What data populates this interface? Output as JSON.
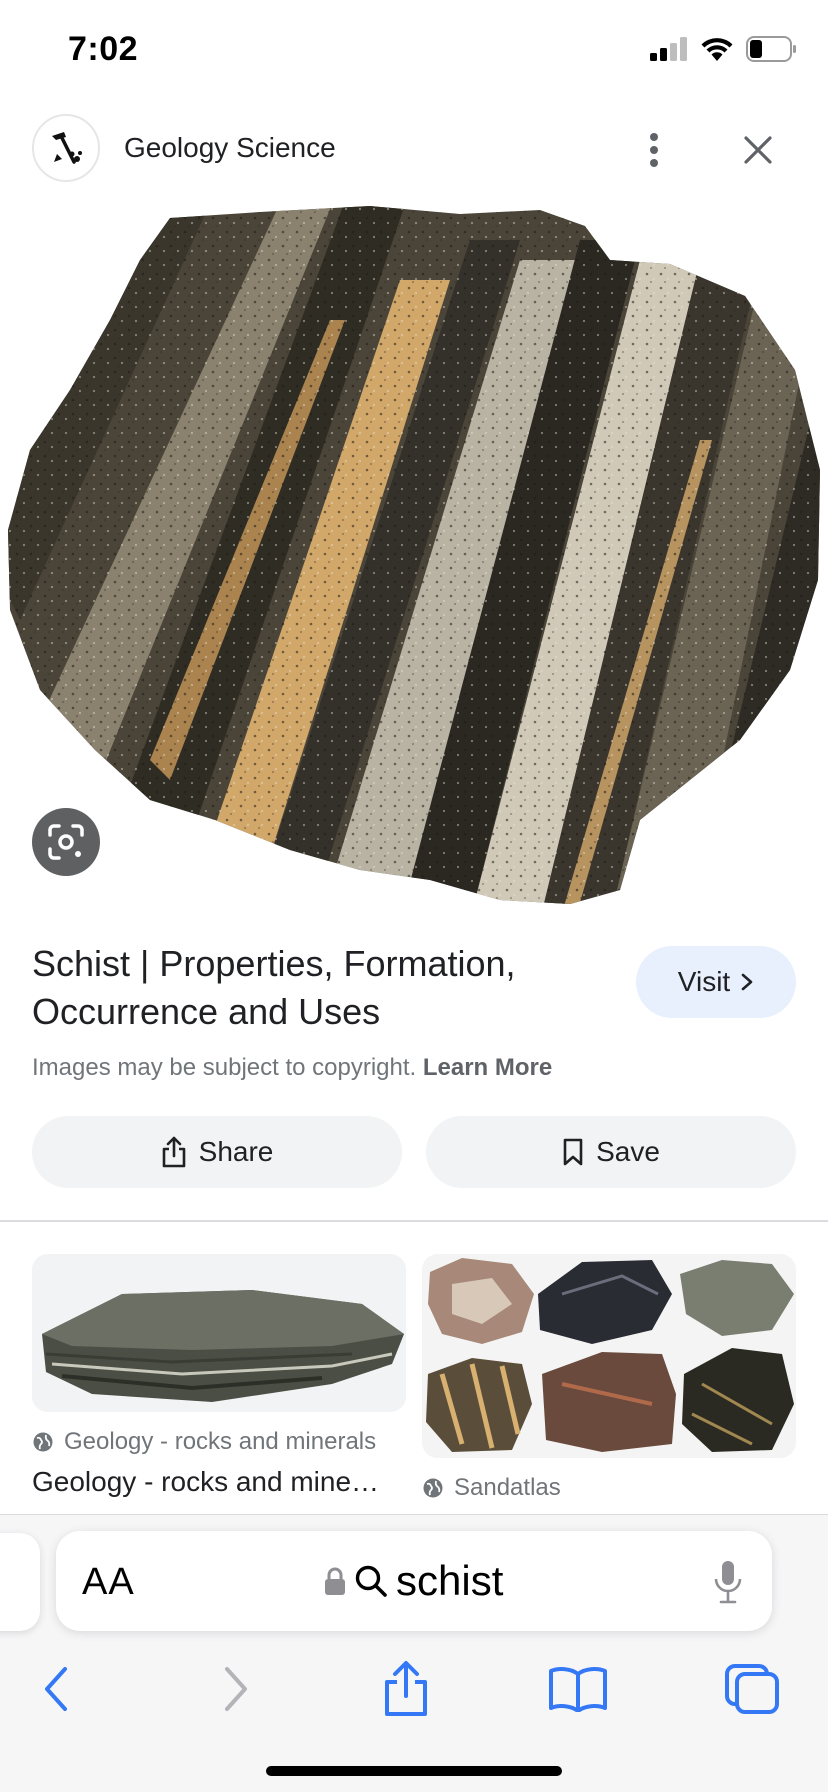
{
  "status_bar": {
    "time": "7:02"
  },
  "header": {
    "site_name": "Geology Science",
    "logo_icon": "rock-hammer-icon"
  },
  "result": {
    "title": "Schist | Properties, Formation, Occurrence and Uses",
    "visit_label": "Visit",
    "copyright_text": "Images may be subject to copyright.",
    "learn_more_label": "Learn More",
    "share_label": "Share",
    "save_label": "Save"
  },
  "related": [
    {
      "source": "Geology - rocks and minerals",
      "title": "Geology - rocks and mine…"
    },
    {
      "source": "Sandatlas"
    }
  ],
  "browser": {
    "aa_label": "AA",
    "url_text": "schist"
  },
  "colors": {
    "accent_blue": "#1a73e8",
    "visit_bg": "#e8f0fe",
    "button_bg": "#f1f3f4",
    "ios_blue": "#3478f6"
  }
}
